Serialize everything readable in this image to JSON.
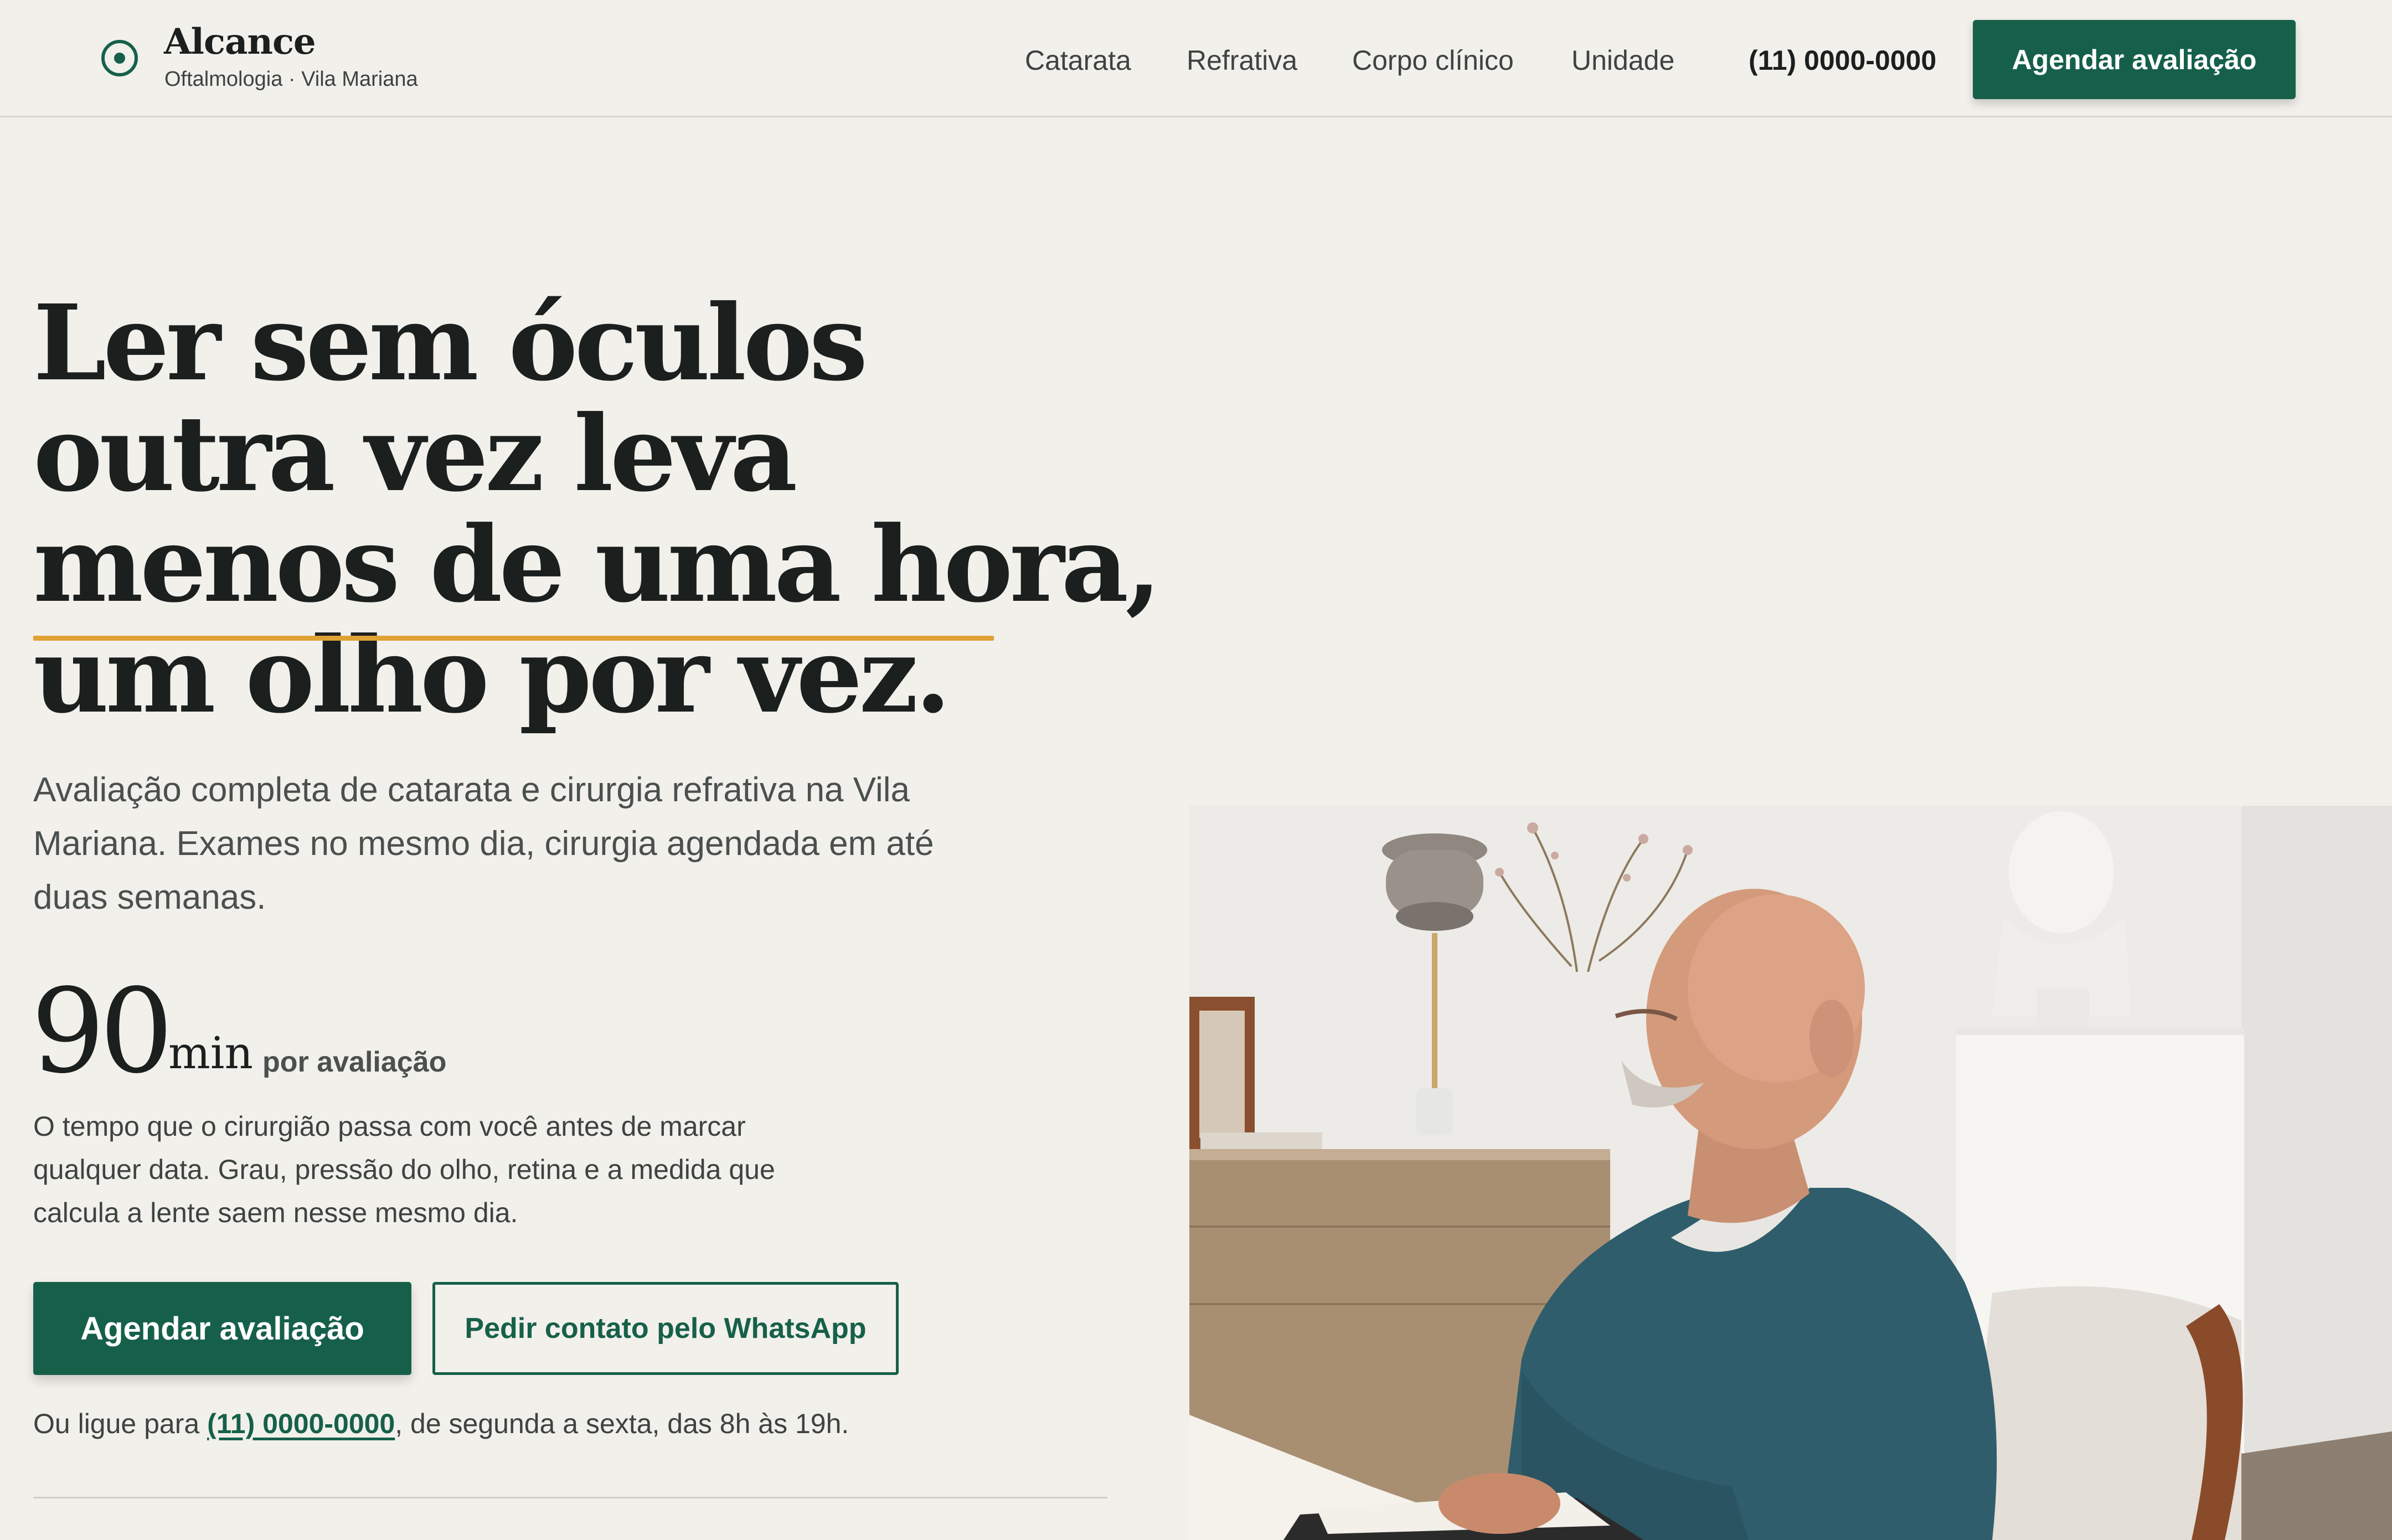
{
  "brand": {
    "name": "Alcance",
    "subtitle": "Oftalmologia · Vila Mariana",
    "logo_icon": "target-circle-icon"
  },
  "nav": {
    "links": [
      "Catarata",
      "Refrativa",
      "Corpo clínico",
      "Unidade"
    ],
    "phone": "(11) 0000-0000",
    "cta_label": "Agendar avaliação"
  },
  "hero": {
    "headline_lines": [
      "Ler sem óculos",
      "outra vez leva",
      "menos de uma hora,",
      "um olho por vez."
    ],
    "subtext": "Avaliação completa de catarata e cirurgia refrativa na Vila Mariana. Exames no mesmo dia, cirurgia agendada em até duas semanas.",
    "stat": {
      "number": "90",
      "unit": "min",
      "caption": "por avaliação",
      "description": "O tempo que o cirurgião passa com você antes de marcar qualquer data. Grau, pressão do olho, retina e a medida que calcula a lente saem nesse mesmo dia."
    },
    "primary_cta": "Agendar avaliação",
    "secondary_cta": "Pedir contato pelo WhatsApp",
    "call_prefix": "Ou ligue para ",
    "call_phone": "(11) 0000-0000",
    "call_suffix": ", de segunda a sexta, das 8h às 19h."
  },
  "colors": {
    "background": "#f2f0eb",
    "brand_green": "#16604a",
    "accent_gold": "#e0a234",
    "text_dark": "#1b1f1e"
  }
}
